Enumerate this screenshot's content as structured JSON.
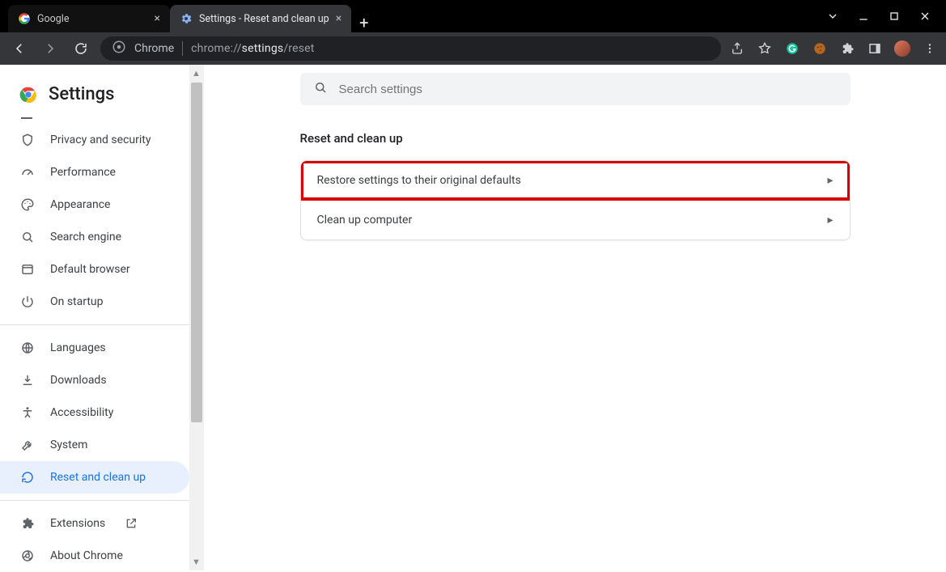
{
  "tabs": [
    {
      "title": "Google",
      "active": false
    },
    {
      "title": "Settings - Reset and clean up",
      "active": true
    }
  ],
  "omnibox": {
    "chrome_label": "Chrome",
    "url_prefix": "chrome://",
    "url_bold": "settings",
    "url_suffix": "/reset"
  },
  "brand": {
    "title": "Settings"
  },
  "search": {
    "placeholder": "Search settings"
  },
  "sidebar": {
    "items_top": [
      {
        "icon": "shield",
        "label": "Privacy and security"
      },
      {
        "icon": "speed",
        "label": "Performance"
      },
      {
        "icon": "palette",
        "label": "Appearance"
      },
      {
        "icon": "search",
        "label": "Search engine"
      },
      {
        "icon": "browser",
        "label": "Default browser"
      },
      {
        "icon": "power",
        "label": "On startup"
      }
    ],
    "items_mid": [
      {
        "icon": "globe",
        "label": "Languages"
      },
      {
        "icon": "download",
        "label": "Downloads"
      },
      {
        "icon": "accessibility",
        "label": "Accessibility"
      },
      {
        "icon": "wrench",
        "label": "System"
      },
      {
        "icon": "restore",
        "label": "Reset and clean up",
        "selected": true
      }
    ],
    "items_bottom": [
      {
        "icon": "puzzle",
        "label": "Extensions",
        "external": true
      },
      {
        "icon": "chrome",
        "label": "About Chrome"
      }
    ]
  },
  "section": {
    "title": "Reset and clean up",
    "rows": [
      {
        "label": "Restore settings to their original defaults",
        "highlight": true
      },
      {
        "label": "Clean up computer",
        "highlight": false
      }
    ]
  }
}
